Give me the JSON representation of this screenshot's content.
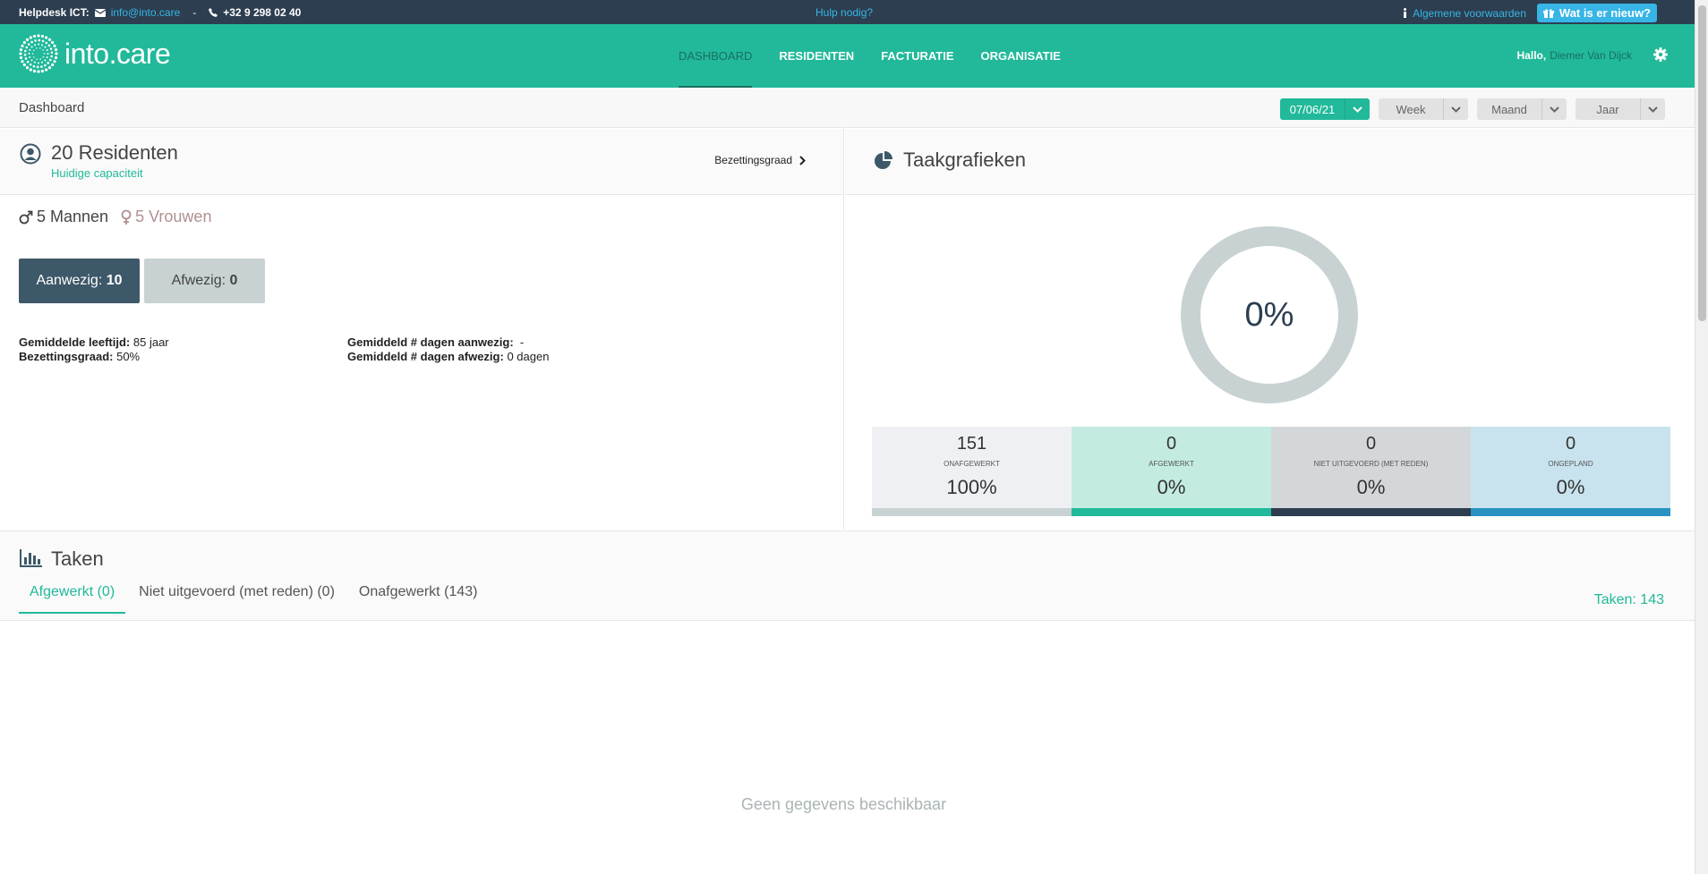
{
  "topbar": {
    "helpdesk_label": "Helpdesk ICT:",
    "email": "info@into.care",
    "separator": "-",
    "phone": "+32 9 298 02 40",
    "help_link": "Hulp nodig?",
    "terms_link": "Algemene voorwaarden",
    "whatsnew": "Wat is er nieuw?"
  },
  "navbar": {
    "brand": "into.care",
    "items": [
      {
        "label": "DASHBOARD",
        "active": true
      },
      {
        "label": "RESIDENTEN",
        "active": false
      },
      {
        "label": "FACTURATIE",
        "active": false
      },
      {
        "label": "ORGANISATIE",
        "active": false
      }
    ],
    "greeting": "Hallo,",
    "user_name": "Diemer Van Dijck"
  },
  "subheader": {
    "title": "Dashboard",
    "date": "07/06/21",
    "week": "Week",
    "month": "Maand",
    "year": "Jaar"
  },
  "residents": {
    "title": "20 Residenten",
    "subtitle": "Huidige capaciteit",
    "occupancy_link": "Bezettingsgraad",
    "men": "5 Mannen",
    "women": "5 Vrouwen",
    "present_label": "Aanwezig:",
    "present_value": "10",
    "absent_label": "Afwezig:",
    "absent_value": "0",
    "avg_age_label": "Gemiddelde leeftijd:",
    "avg_age_value": "85 jaar",
    "occupancy_label": "Bezettingsgraad:",
    "occupancy_value": "50%",
    "avg_days_present_label": "Gemiddeld # dagen aanwezig:",
    "avg_days_present_value": "-",
    "avg_days_absent_label": "Gemiddeld # dagen afwezig:",
    "avg_days_absent_value": "0 dagen"
  },
  "task_charts": {
    "title": "Taakgrafieken",
    "donut_label": "0%",
    "donut_completed_fraction": 0,
    "tiles": [
      {
        "count": "151",
        "caption": "ONAFGEWERKT",
        "percent": "100%",
        "color": "#c8d2d2",
        "bg": "#eef0f3"
      },
      {
        "count": "0",
        "caption": "AFGEWERKT",
        "percent": "0%",
        "color": "#21b99a",
        "bg": "#c3ebe1"
      },
      {
        "count": "0",
        "caption": "NIET UITGEVOERD (MET REDEN)",
        "percent": "0%",
        "color": "#2c3e50",
        "bg": "#d3d7da"
      },
      {
        "count": "0",
        "caption": "ONGEPLAND",
        "percent": "0%",
        "color": "#2992c2",
        "bg": "#c8e3ee"
      }
    ]
  },
  "tasks": {
    "title": "Taken",
    "tabs": [
      {
        "label": "Afgewerkt (0)",
        "active": true
      },
      {
        "label": "Niet uitgevoerd (met reden) (0)",
        "active": false
      },
      {
        "label": "Onafgewerkt (143)",
        "active": false
      }
    ],
    "count": "Taken: 143",
    "empty": "Geen gegevens beschikbaar"
  },
  "colors": {
    "brand": "#21b99a",
    "topbar": "#2c3e50",
    "link": "#37b5e6"
  }
}
